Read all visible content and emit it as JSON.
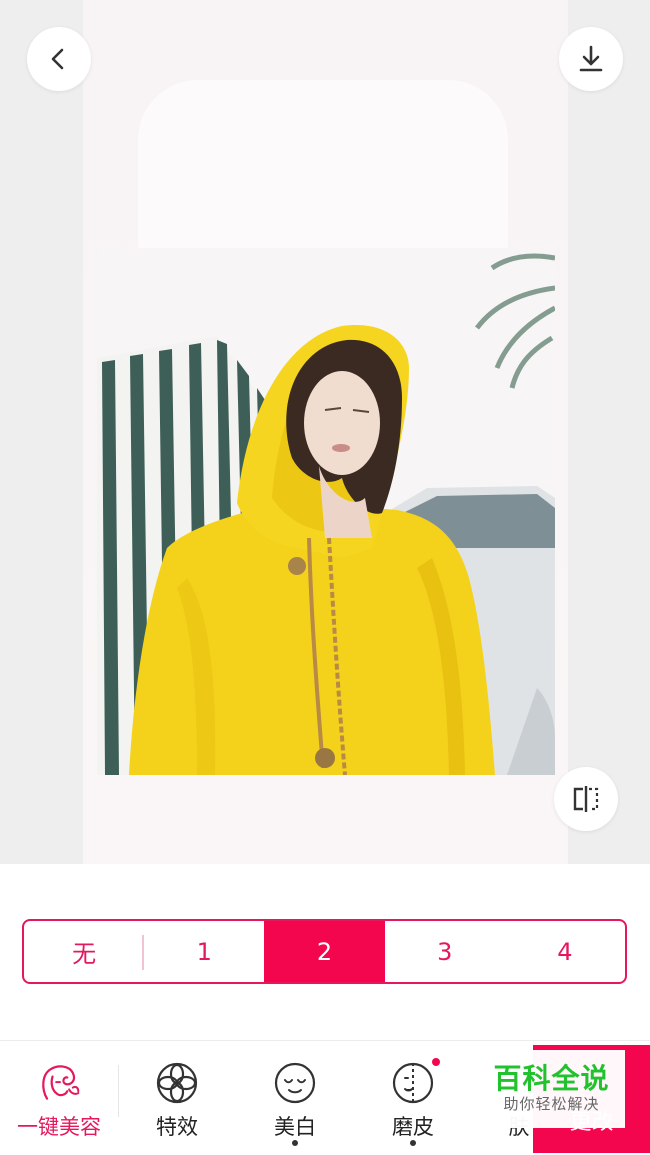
{
  "levels": {
    "options": [
      "无",
      "1",
      "2",
      "3",
      "4"
    ],
    "selected": "2"
  },
  "tools": [
    {
      "label": "一键美容",
      "icon": "face-makeup-icon"
    },
    {
      "label": "特效",
      "icon": "flower-icon"
    },
    {
      "label": "美白",
      "icon": "smile-face-icon"
    },
    {
      "label": "磨皮",
      "icon": "half-face-icon"
    },
    {
      "label": "肤",
      "icon": "skin-icon"
    }
  ],
  "save_label": "更改",
  "watermark": {
    "title": "百科全说",
    "subtitle": "助你轻松解决"
  },
  "colors": {
    "accent": "#f4064f",
    "accent_text": "#e5185d",
    "watermark_green": "#22c22e"
  }
}
